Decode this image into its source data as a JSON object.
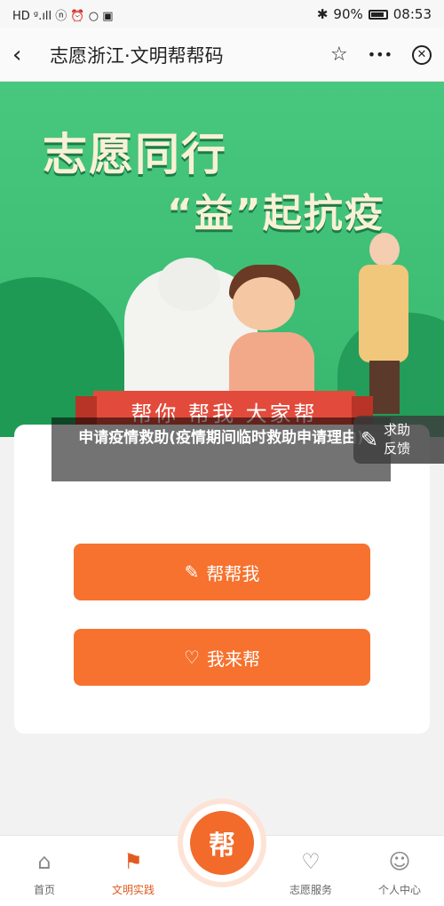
{
  "status_bar": {
    "left_icons": "HD ᵍ.ıll ⓝ ⏰ ○ ▣",
    "bt": "✱",
    "battery": "90%",
    "time": "08:53"
  },
  "header": {
    "title": "志愿浙江·文明帮帮码",
    "back_icon": "‹",
    "star_icon": "☆",
    "more_icon": "•••",
    "close_icon": "✕"
  },
  "banner": {
    "headline_1": "志愿同行",
    "headline_2": "“益”起抗疫",
    "ribbon": "帮你 帮我 大家帮"
  },
  "caption": "申请疫情救助(疫情期间临时救助申请理由)",
  "feedback": {
    "line1": "求助",
    "line2": "反馈",
    "icon": "✎"
  },
  "buttons": {
    "help_me": "帮帮我",
    "help_me_icon": "✎",
    "i_help": "我来帮",
    "i_help_icon": "♡"
  },
  "bottom_nav": {
    "items": [
      {
        "label": "首页",
        "icon": "⌂"
      },
      {
        "label": "文明实践",
        "icon": "⚑"
      },
      {
        "label": "志愿服务",
        "icon": "♡"
      },
      {
        "label": "个人中心",
        "icon": "☺"
      }
    ],
    "center_badge": "帮"
  },
  "colors": {
    "accent": "#f6722e",
    "banner_green": "#3dbd74",
    "ribbon_red": "#e24b3c"
  }
}
